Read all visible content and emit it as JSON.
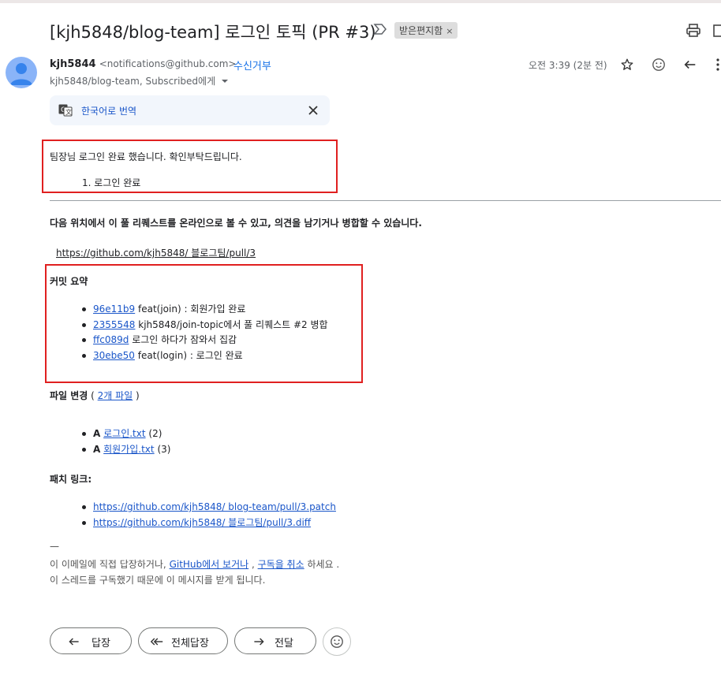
{
  "email": {
    "subject": "[kjh5848/blog-team] 로그인 토픽 (PR #3)",
    "label": "받은편지함",
    "label_close": "×",
    "sender_name": "kjh5844",
    "sender_address": "<notifications@github.com>",
    "unsubscribe": "수신거부",
    "to_line": "kjh5848/blog-team, Subscribed에게",
    "time": "오전 3:39 (2분 전)"
  },
  "translate": {
    "label": "한국어로 번역"
  },
  "message": {
    "line1": "팀장님 로그인 완료 했습니다. 확인부탁드립니다.",
    "list_item": "1. 로그인 완료"
  },
  "github": {
    "intro": "다음 위치에서 이 풀 리퀘스트를 온라인으로 볼 수 있고, 의견을 남기거나 병합할 수 있습니다.",
    "pr_link": "https://github.com/kjh5848/ 블로그팀/pull/3",
    "commits_title": "커밋 요약",
    "commits": [
      {
        "sha": "96e11b9",
        "msg": " feat(join) : 회원가입 완료"
      },
      {
        "sha": "2355548",
        "msg": " kjh5848/join-topic에서 풀 리퀘스트 #2 병합"
      },
      {
        "sha": "ffc089d",
        "msg": " 로그인 하다가 잠와서 집감"
      },
      {
        "sha": "30ebe50",
        "msg": " feat(login) : 로그인 완료"
      }
    ],
    "files_title": "파일 변경",
    "files_open": " ( ",
    "files_link": "2개 파일",
    "files_close": " )",
    "files": [
      {
        "op": "A",
        "name": "로그인.txt",
        "count": " (2)"
      },
      {
        "op": "A",
        "name": "회원가입.txt",
        "count": " (3)"
      }
    ],
    "patch_title": "패치 링크:",
    "patch_links": [
      "https://github.com/kjh5848/ blog-team/pull/3.patch",
      "https://github.com/kjh5848/ 블로그팀/pull/3.diff"
    ],
    "sig_dash": "—",
    "footer1_a": "이 이메일에 직접 답장하거나, ",
    "footer1_link1": "GitHub에서 보거나",
    "footer1_sep": " , ",
    "footer1_link2": "구독을 취소",
    "footer1_b": " 하세요 .",
    "footer2": "이 스레드를 구독했기 때문에 이 메시지를 받게 됩니다."
  },
  "actions": {
    "reply": "답장",
    "reply_all": "전체답장",
    "forward": "전달"
  },
  "colors": {
    "link": "#1a56c9",
    "highlight_box": "#e02020",
    "avatar": "#8ab4f8"
  }
}
